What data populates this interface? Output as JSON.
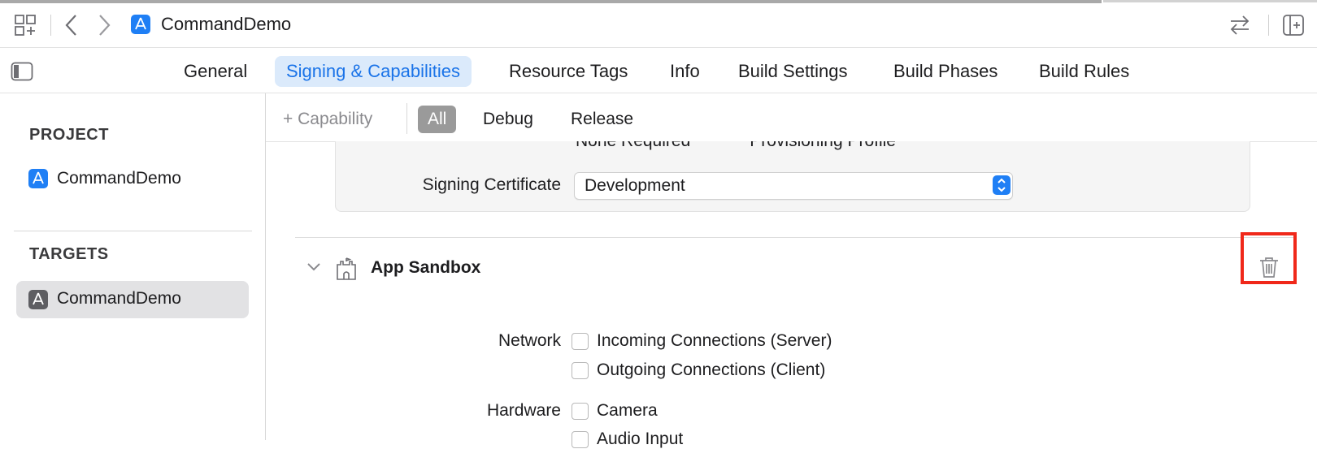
{
  "window": {
    "app_name": "CommandDemo",
    "icons": {
      "grid": "grid-layout-icon",
      "back": "chevron-left-icon",
      "forward": "chevron-right-icon",
      "app": "xcode-app-icon",
      "swap": "swap-arrows-icon",
      "add_editor": "add-editor-icon",
      "sidebar_toggle": "sidebar-toggle-icon"
    }
  },
  "tabs": [
    {
      "label": "General",
      "active": false
    },
    {
      "label": "Signing & Capabilities",
      "active": true
    },
    {
      "label": "Resource Tags",
      "active": false
    },
    {
      "label": "Info",
      "active": false
    },
    {
      "label": "Build Settings",
      "active": false
    },
    {
      "label": "Build Phases",
      "active": false
    },
    {
      "label": "Build Rules",
      "active": false
    }
  ],
  "sidebar": {
    "project_header": "PROJECT",
    "project_item": "CommandDemo",
    "targets_header": "TARGETS",
    "target_item": "CommandDemo"
  },
  "toolbar": {
    "add_capability": "+ Capability",
    "filters": [
      {
        "label": "All",
        "active": true
      },
      {
        "label": "Debug",
        "active": false
      },
      {
        "label": "Release",
        "active": false
      }
    ]
  },
  "signing": {
    "provisioning_label": "Provisioning Profile",
    "provisioning_value": "None Required",
    "certificate_label": "Signing Certificate",
    "certificate_value": "Development"
  },
  "sandbox": {
    "title": "App Sandbox",
    "network_label": "Network",
    "network_options": [
      "Incoming Connections (Server)",
      "Outgoing Connections (Client)"
    ],
    "hardware_label": "Hardware",
    "hardware_options": [
      "Camera",
      "Audio Input"
    ]
  },
  "colors": {
    "accent": "#1a73e8",
    "active_tab_bg": "#dbeafb",
    "highlight_box": "#f0281a"
  }
}
